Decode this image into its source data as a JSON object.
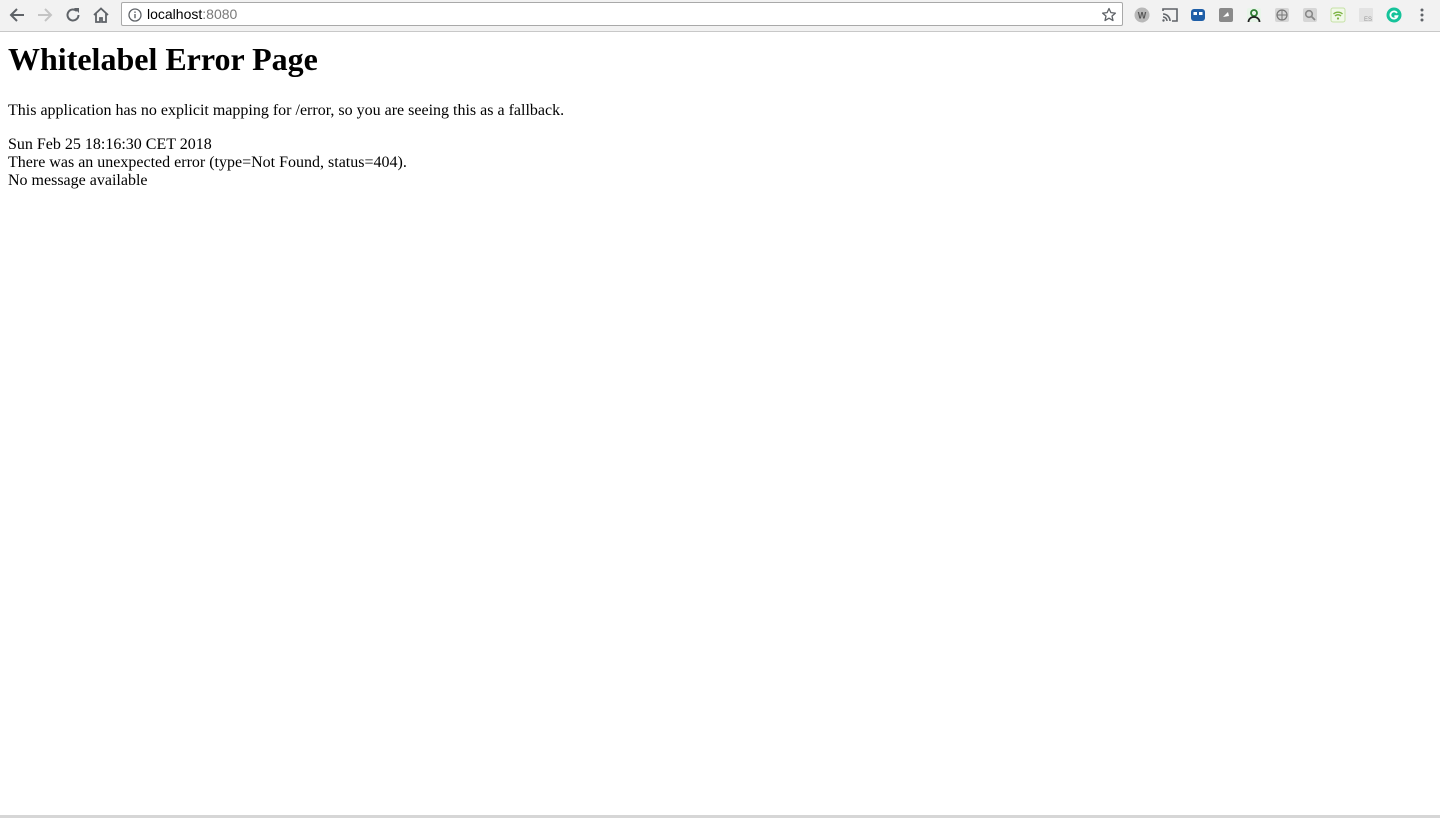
{
  "browser": {
    "url_host": "localhost",
    "url_port": ":8080",
    "icons": {
      "back": "arrow-left-icon",
      "forward": "arrow-right-icon",
      "reload": "reload-icon",
      "home": "home-icon",
      "info": "info-icon",
      "bookmark": "star-icon",
      "menu": "kebab-menu-icon"
    },
    "extensions": [
      {
        "name": "w-extension-icon",
        "color": "#8a8a8a"
      },
      {
        "name": "cast-icon",
        "color": "#5f6368"
      },
      {
        "name": "blue-extension-icon",
        "color": "#1f5fa8"
      },
      {
        "name": "gray-square-extension-icon",
        "color": "#8a8a8a"
      },
      {
        "name": "green-person-extension-icon",
        "color": "#2e7d32"
      },
      {
        "name": "globe-extension-icon",
        "color": "#8a8a8a"
      },
      {
        "name": "search-extension-icon",
        "color": "#9a9a9a"
      },
      {
        "name": "wifi-extension-icon",
        "color": "#7cb342"
      },
      {
        "name": "es-extension-icon",
        "color": "#b0b0b0"
      },
      {
        "name": "grammarly-icon",
        "color": "#15c39a"
      }
    ]
  },
  "page": {
    "title": "Whitelabel Error Page",
    "fallback_text": "This application has no explicit mapping for /error, so you are seeing this as a fallback.",
    "timestamp": "Sun Feb 25 18:16:30 CET 2018",
    "error_text": "There was an unexpected error (type=Not Found, status=404).",
    "message": "No message available"
  }
}
